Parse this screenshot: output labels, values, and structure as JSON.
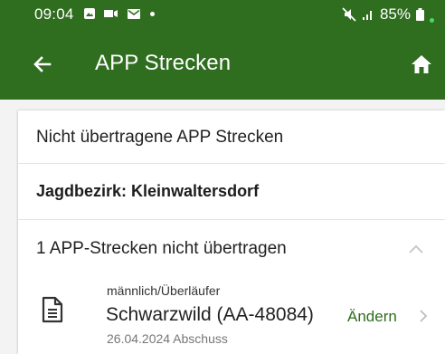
{
  "status_bar": {
    "time": "09:04",
    "battery": "85%",
    "icons_left": [
      "photo-icon",
      "cast-icon",
      "mail-icon",
      "dot-icon"
    ],
    "icons_right": [
      "mute-icon",
      "signal-icon",
      "battery-icon"
    ]
  },
  "app_bar": {
    "title": "APP Strecken",
    "back_icon": "arrow-left-icon",
    "home_icon": "home-icon",
    "color": "#2f6d1f"
  },
  "content": {
    "header": "Nicht übertragene APP Strecken",
    "district": "Jagdbezirk: Kleinwaltersdorf",
    "section": {
      "label": "1 APP-Strecken nicht übertragen",
      "expanded": true
    },
    "entries": [
      {
        "category": "männlich/Überläufer",
        "name": "Schwarzwild (AA-48084)",
        "date": "26.04.2024 Abschuss",
        "action": "Ändern",
        "icon": "document-icon"
      }
    ]
  }
}
